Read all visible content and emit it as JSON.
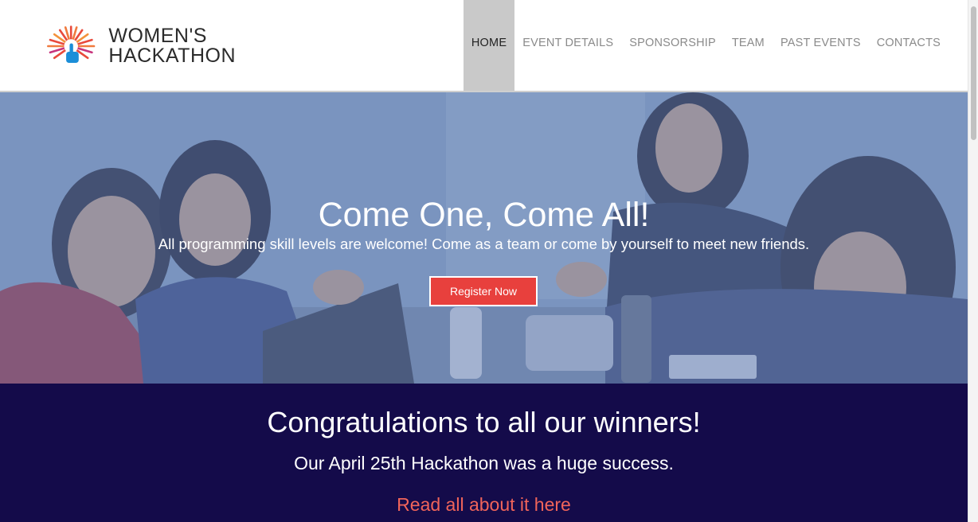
{
  "header": {
    "logo": {
      "line1": "WOMEN'S",
      "line2": "HACKATHON"
    },
    "nav": [
      {
        "label": "HOME",
        "active": true
      },
      {
        "label": "EVENT DETAILS",
        "active": false
      },
      {
        "label": "SPONSORSHIP",
        "active": false
      },
      {
        "label": "TEAM",
        "active": false
      },
      {
        "label": "PAST EVENTS",
        "active": false
      },
      {
        "label": "CONTACTS",
        "active": false
      }
    ]
  },
  "hero": {
    "title": "Come One, Come All!",
    "subtitle": "All programming skill levels are welcome! Come as a team or come by yourself to meet new friends.",
    "register_label": "Register Now"
  },
  "congrats": {
    "title": "Congratulations to all our winners!",
    "subtitle": "Our April 25th Hackathon was a huge success.",
    "link": "Read all about it here"
  },
  "colors": {
    "accent": "#e8403d",
    "band_bg": "#140b4a",
    "link": "#f0645a",
    "nav_active_bg": "#c9c9c9"
  }
}
